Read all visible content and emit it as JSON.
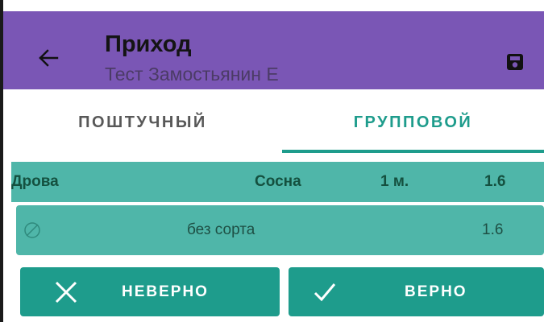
{
  "toolbar": {
    "title": "Приход",
    "subtitle": "Тест  Замостьянин Е",
    "back_icon": "arrow-left-icon",
    "save_icon": "save-icon"
  },
  "tabs": [
    {
      "label": "ПОШТУЧНЫЙ",
      "selected": false
    },
    {
      "label": "ГРУППОВОЙ",
      "selected": true
    }
  ],
  "group_header": {
    "product": "Дрова",
    "species": "Сосна",
    "length": "1 м.",
    "volume": "1.6"
  },
  "items": [
    {
      "icon": "no-grade-icon",
      "grade": "без сорта",
      "volume": "1.6"
    }
  ],
  "buttons": {
    "wrong_label": "НЕВЕРНО",
    "right_label": "ВЕРНО",
    "wrong_icon": "close-icon",
    "right_icon": "check-icon"
  },
  "colors": {
    "toolbar": "#7a56b5",
    "accent": "#1e9c8c",
    "row": "#4fb6a9"
  }
}
